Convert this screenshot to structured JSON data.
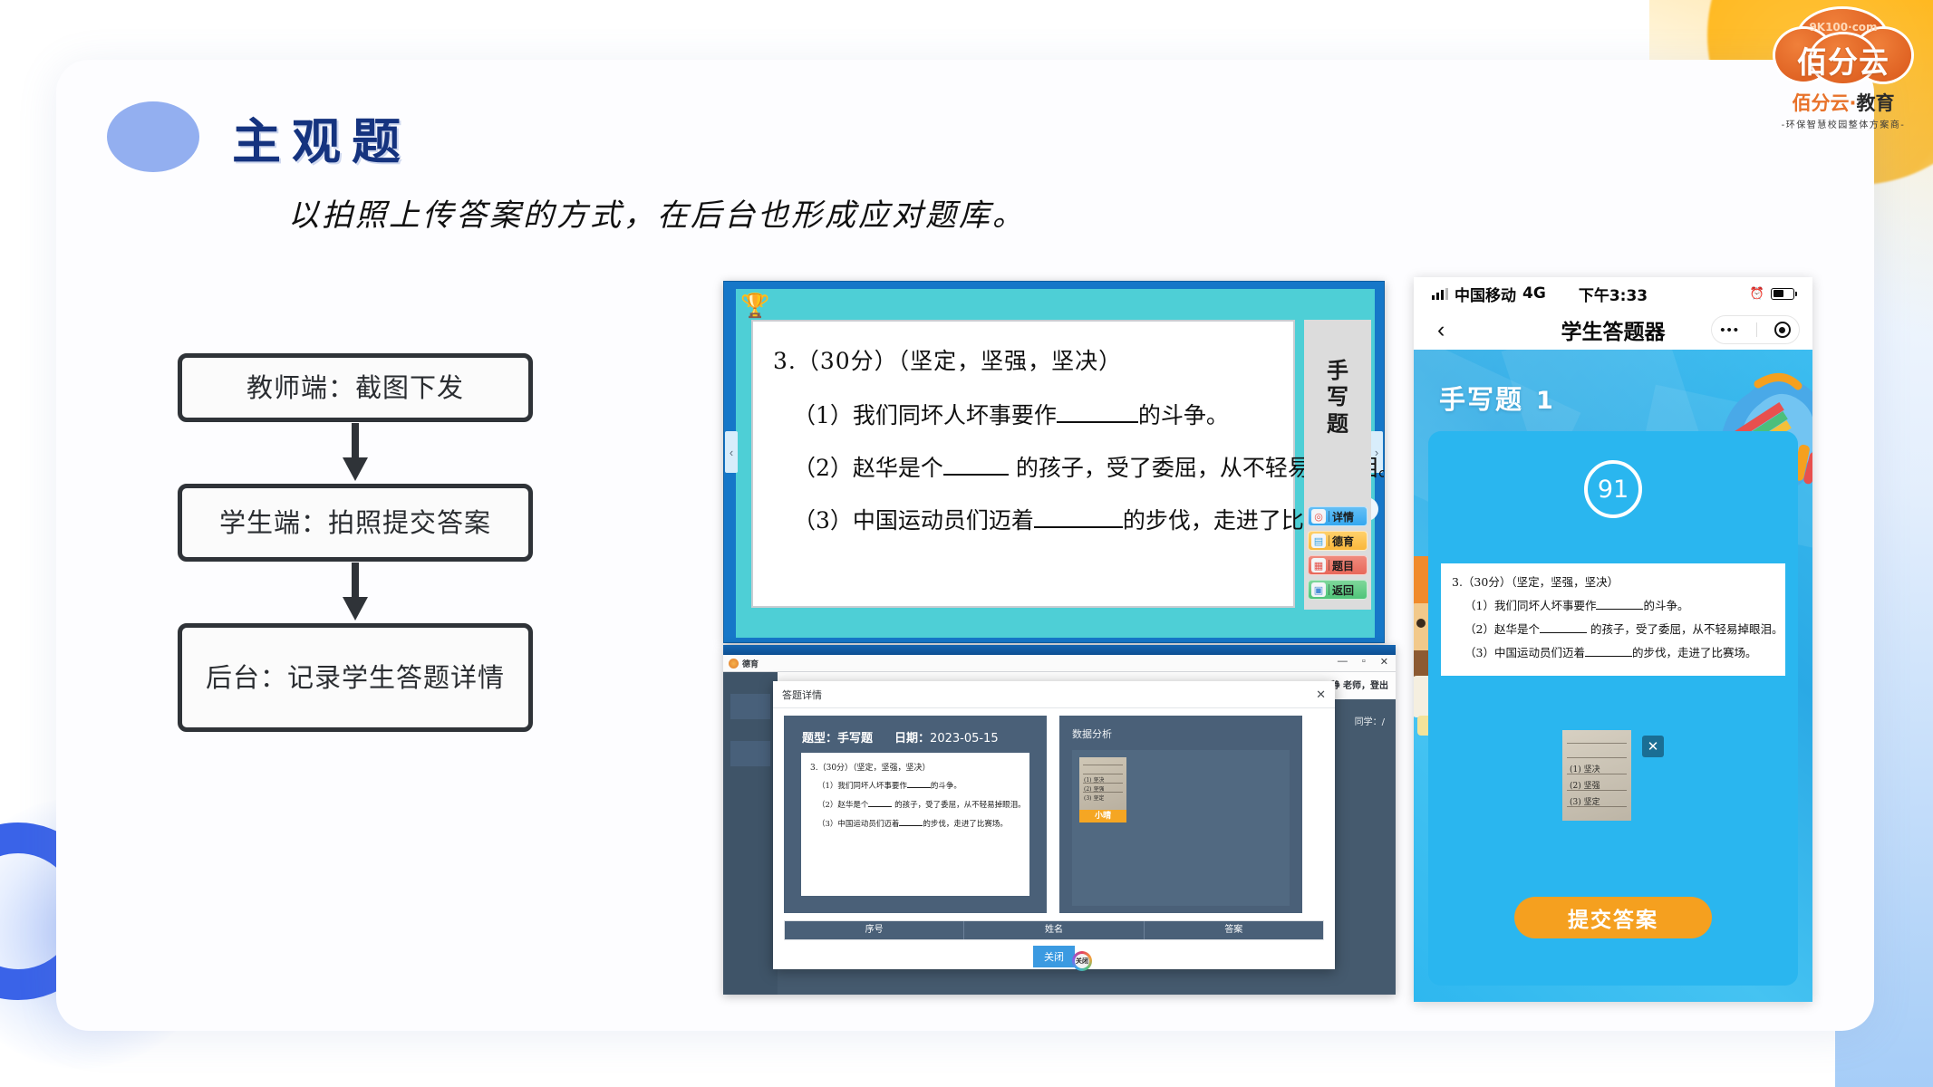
{
  "page": {
    "title": "主观题",
    "subtitle": "以拍照上传答案的方式，在后台也形成应对题库。"
  },
  "flow": {
    "steps": [
      {
        "label": "教师端：截图下发"
      },
      {
        "label": "学生端：拍照提交答案"
      },
      {
        "label": "后台：记录学生答题详情"
      }
    ]
  },
  "question_shot": {
    "trophy_icon": "trophy-icon",
    "sidebar_title": "手写题",
    "arrow_left": "‹",
    "arrow_right": "›",
    "buttons": [
      {
        "label": "详情",
        "icon": "target-icon",
        "glyph": "◎",
        "color": "#35a7ef"
      },
      {
        "label": "德育",
        "icon": "list-icon",
        "glyph": "▤",
        "color": "#f9b73c"
      },
      {
        "label": "题目",
        "icon": "paper-icon",
        "glyph": "▦",
        "color": "#e8685a"
      },
      {
        "label": "返回",
        "icon": "return-icon",
        "glyph": "▣",
        "color": "#4fc479"
      }
    ],
    "paper": {
      "heading": "3.（30分）（坚定，坚强，坚决）",
      "items": [
        {
          "pre": "（1）我们同坏人坏事要作",
          "post": "的斗争。"
        },
        {
          "pre": "（2）赵华是个",
          "post": " 的孩子，受了委屈，从不轻易掉眼泪。"
        },
        {
          "pre": "（3）中国运动员们迈着",
          "post": "的步伐，走进了比赛场。"
        }
      ]
    }
  },
  "desktop_shot": {
    "tab_label": "德育",
    "window_buttons": {
      "minimize": "—",
      "maximize": "▫",
      "close": "✕"
    },
    "user_info": "静 老师，登出",
    "sub_info": "同学：/",
    "dialog": {
      "title": "答题详情",
      "close_icon": "✕",
      "meta": {
        "type_label": "题型：",
        "type_value": "手写题",
        "date_label": "日期：",
        "date_value": "2023-05-15"
      },
      "paper": {
        "heading": "3.（30分）（坚定，坚强，坚决）",
        "items": [
          {
            "pre": "（1）我们同坏人坏事要作",
            "post": "的斗争。"
          },
          {
            "pre": "（2）赵华是个",
            "post": " 的孩子，受了委屈，从不轻易掉眼泪。"
          },
          {
            "pre": "（3）中国运动员们迈着",
            "post": "的步伐，走进了比赛场。"
          }
        ]
      },
      "analysis": {
        "title": "数据分析",
        "thumb_name": "小晴",
        "thumb_lines": [
          "(1) 坚决",
          "(2) 坚强",
          "(3) 坚定"
        ]
      },
      "table_headers": [
        "序号",
        "姓名",
        "答案"
      ],
      "close_button": "关闭",
      "cursor_label": "关闭"
    }
  },
  "phone_shot": {
    "status": {
      "carrier": "中国移动",
      "network": "4G",
      "time": "下午3:33",
      "alarm_icon": "alarm-icon",
      "battery_icon": "battery-icon"
    },
    "nav": {
      "back_icon": "‹",
      "title": "学生答题器",
      "more_icon": "•••",
      "target_icon": "target-icon"
    },
    "hero": {
      "title": "手写题",
      "number": "1",
      "timer": "91"
    },
    "question": {
      "heading": "3.（30分）（坚定，坚强，坚决）",
      "items": [
        {
          "pre": "（1）我们同坏人坏事要作",
          "post": "的斗争。"
        },
        {
          "pre": "（2）赵华是个",
          "post": " 的孩子，受了委屈，从不轻易掉眼泪。"
        },
        {
          "pre": "（3）中国运动员们迈着",
          "post": "的步伐，走进了比赛场。"
        }
      ]
    },
    "answer": {
      "lines": [
        "(1) 坚决",
        "(2) 坚强",
        "(3) 坚定"
      ],
      "delete_icon": "✕"
    },
    "submit_button": "提交答案"
  },
  "logo": {
    "domain": "9K100·com",
    "cloud_text": "佰分云",
    "brand_orange": "佰分云",
    "brand_dot": "·",
    "brand_black": "教育",
    "tagline": "-环保智慧校园整体方案商-"
  },
  "colors": {
    "title_blue": "#15337f",
    "bullet_blue": "#93aff0",
    "accent_orange": "#f5a01f",
    "phone_blue": "#2ab6ef",
    "dialog_panel": "#4a6078"
  }
}
